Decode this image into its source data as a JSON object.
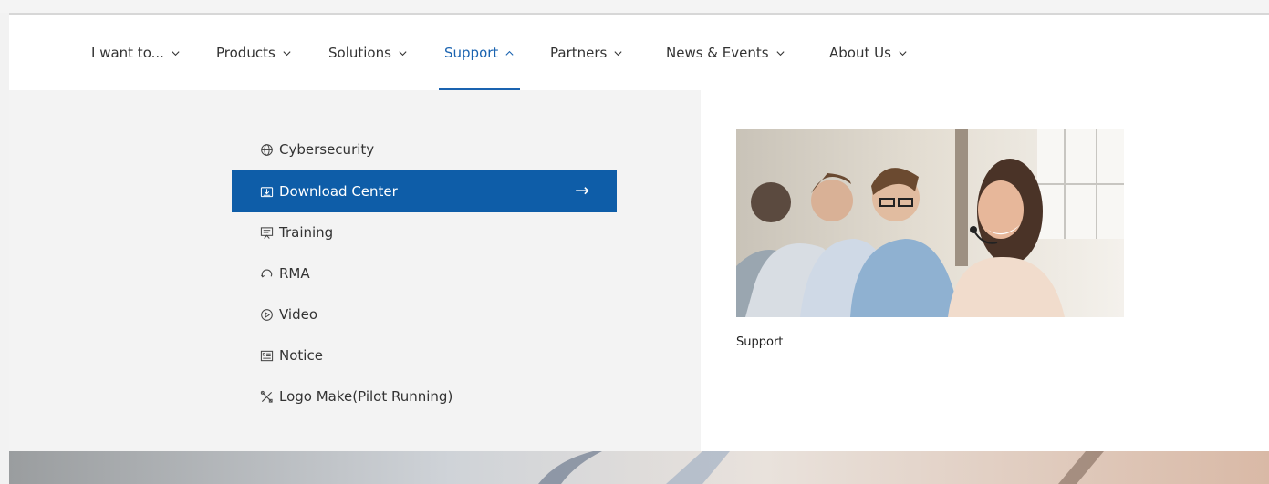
{
  "nav": {
    "items": [
      {
        "label": "I want to...",
        "chevron": "chevron-down-icon",
        "active": false
      },
      {
        "label": "Products",
        "chevron": "chevron-down-icon",
        "active": false
      },
      {
        "label": "Solutions",
        "chevron": "chevron-down-icon",
        "active": false
      },
      {
        "label": "Support",
        "chevron": "chevron-up-icon",
        "active": true
      },
      {
        "label": "Partners",
        "chevron": "chevron-down-icon",
        "active": false
      },
      {
        "label": "News & Events",
        "chevron": "chevron-down-icon",
        "active": false
      },
      {
        "label": "About Us",
        "chevron": "chevron-down-icon",
        "active": false
      }
    ]
  },
  "support_menu": {
    "items": [
      {
        "label": "Cybersecurity",
        "icon": "globe-icon",
        "selected": false
      },
      {
        "label": "Download Center",
        "icon": "download-icon",
        "selected": true,
        "arrow": "→"
      },
      {
        "label": "Training",
        "icon": "presentation-icon",
        "selected": false
      },
      {
        "label": "RMA",
        "icon": "refresh-icon",
        "selected": false
      },
      {
        "label": "Video",
        "icon": "play-circle-icon",
        "selected": false
      },
      {
        "label": "Notice",
        "icon": "notice-icon",
        "selected": false
      },
      {
        "label": "Logo Make(Pilot Running)",
        "icon": "tools-icon",
        "selected": false
      }
    ]
  },
  "feature": {
    "caption": "Support"
  },
  "colors": {
    "accent": "#1a63b0",
    "selected_bg": "#0e5da8",
    "panel_bg": "#f3f3f3"
  }
}
